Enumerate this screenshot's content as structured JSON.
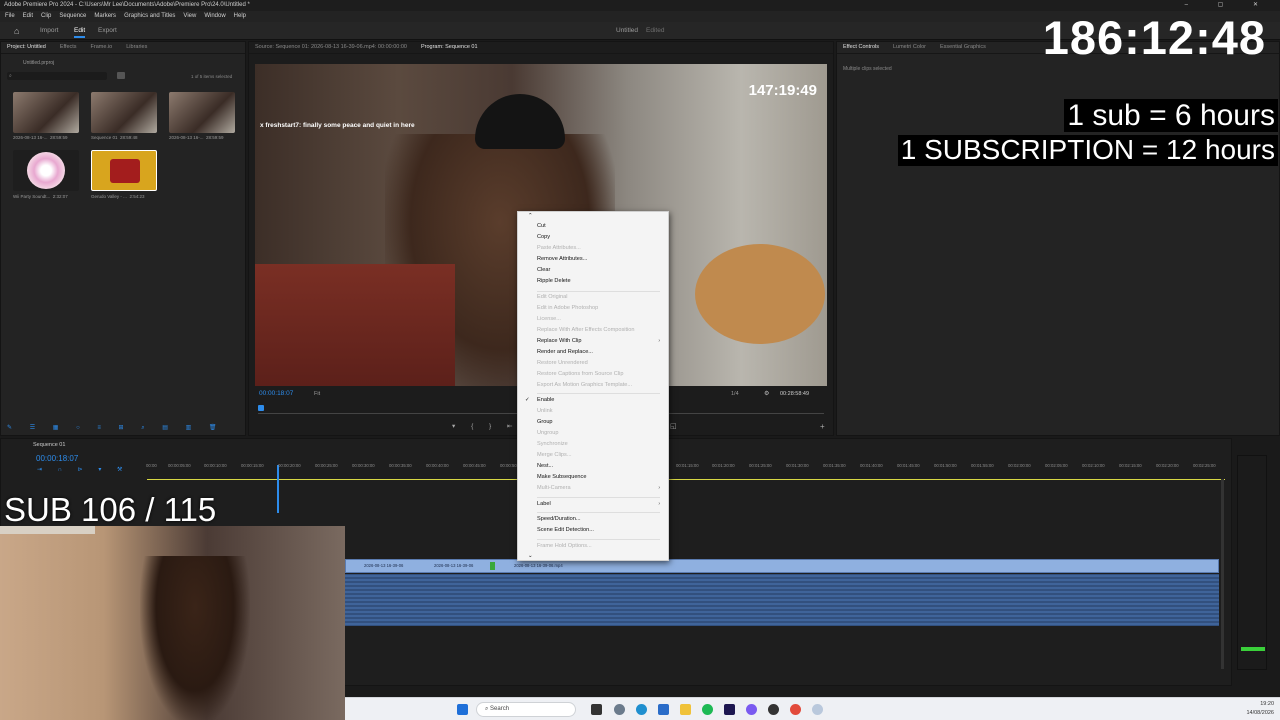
{
  "app": {
    "title": "Adobe Premiere Pro 2024 - C:\\Users\\Mr Lee\\Documents\\Adobe\\Premiere Pro\\24.0\\Untitled *",
    "menu": [
      "File",
      "Edit",
      "Clip",
      "Sequence",
      "Markers",
      "Graphics and Titles",
      "View",
      "Window",
      "Help"
    ],
    "workspace_tabs": [
      "Import",
      "Edit",
      "Export"
    ],
    "active_workspace": "Edit",
    "doc_title": "Untitled",
    "doc_status": "Edited"
  },
  "project_panel": {
    "tabs": [
      "Project: Untitled",
      "Effects",
      "Frame.io",
      "Libraries"
    ],
    "project_file": "Untitled.prproj",
    "selection_info": "1 of 5 items selected",
    "items": [
      {
        "name": "2026-08-13 16-...",
        "duration": "28:59:59",
        "color": "#6b5a52"
      },
      {
        "name": "Sequence 01",
        "duration": "28:59:48",
        "color": "#6b5a52"
      },
      {
        "name": "2026-08-13 16-...",
        "duration": "28:59:59",
        "color": "#6b5a52"
      },
      {
        "name": "Wii Party Soundt...",
        "duration": "2:32:07",
        "color": "#e8c6d8"
      },
      {
        "name": "Gerudo Valley - ...",
        "duration": "2:54:23",
        "color": "#d8a51e"
      }
    ]
  },
  "source_monitor": {
    "tab": "Source: Sequence 01: 2026-08-13 16-39-06.mp4: 00:00:00:00",
    "program_tab": "Program: Sequence 01"
  },
  "program_monitor": {
    "overlay_timecode": "147:19:49",
    "chat_message": "x freshstart7: finally some peace and quiet in here",
    "current_time": "00:00:18:07",
    "fit": "Fit",
    "quality": "1/4",
    "duration": "00:28:58:49"
  },
  "effect_controls": {
    "tabs": [
      "Effect Controls",
      "Lumetri Color",
      "Essential Graphics"
    ],
    "status": "Multiple clips selected"
  },
  "context_menu": {
    "items": [
      {
        "label": "Cut",
        "enabled": true
      },
      {
        "label": "Copy",
        "enabled": true
      },
      {
        "label": "Paste Attributes...",
        "enabled": false
      },
      {
        "label": "Remove Attributes...",
        "enabled": true
      },
      {
        "label": "Clear",
        "enabled": true
      },
      {
        "label": "Ripple Delete",
        "enabled": true
      },
      {
        "label": "Edit Original",
        "enabled": false
      },
      {
        "label": "Edit in Adobe Photoshop",
        "enabled": false
      },
      {
        "label": "License...",
        "enabled": false
      },
      {
        "label": "Replace With After Effects Composition",
        "enabled": false
      },
      {
        "label": "Replace With Clip",
        "enabled": true,
        "submenu": true
      },
      {
        "label": "Render and Replace...",
        "enabled": true
      },
      {
        "label": "Restore Unrendered",
        "enabled": false
      },
      {
        "label": "Restore Captions from Source Clip",
        "enabled": false
      },
      {
        "label": "Export As Motion Graphics Template...",
        "enabled": false
      },
      {
        "label": "Enable",
        "enabled": true,
        "checked": true
      },
      {
        "label": "Unlink",
        "enabled": false
      },
      {
        "label": "Group",
        "enabled": true
      },
      {
        "label": "Ungroup",
        "enabled": false
      },
      {
        "label": "Synchronize",
        "enabled": false
      },
      {
        "label": "Merge Clips...",
        "enabled": false
      },
      {
        "label": "Nest...",
        "enabled": true
      },
      {
        "label": "Make Subsequence",
        "enabled": true
      },
      {
        "label": "Multi-Camera",
        "enabled": false,
        "submenu": true
      },
      {
        "label": "Label",
        "enabled": true,
        "submenu": true
      },
      {
        "label": "Speed/Duration...",
        "enabled": true
      },
      {
        "label": "Scene Edit Detection...",
        "enabled": true
      },
      {
        "label": "Frame Hold Options...",
        "enabled": false
      }
    ]
  },
  "timeline": {
    "tab": "Sequence 01",
    "current_time": "00:00:18:07",
    "ruler": [
      "00:00",
      "00:00:05:00",
      "00:00:10:00",
      "00:00:15:00",
      "00:00:20:00",
      "00:00:25:00",
      "00:00:30:00",
      "00:00:35:00",
      "00:00:40:00",
      "00:00:45:00",
      "00:00:50:00",
      "00:01:15:00",
      "00:01:20:00",
      "00:01:25:00",
      "00:01:30:00",
      "00:01:35:00",
      "00:01:40:00",
      "00:01:45:00",
      "00:01:50:00",
      "00:01:55:00",
      "00:02:00:00",
      "00:02:05:00",
      "00:02:10:00",
      "00:02:15:00",
      "00:02:20:00",
      "00:02:25:00"
    ],
    "clips": [
      "2026-08-13 16-39-06",
      "2026-08-13 16-39-06",
      "2026-08-13 16-39-06.mp4"
    ]
  },
  "stream_overlay": {
    "big_timer": "186:12:48",
    "promo_line1": "1 sub = 6 hours",
    "promo_line2": "1 SUBSCRIPTION = 12 hours",
    "sub_counter": "SUB 106 / 115"
  },
  "taskbar": {
    "search_placeholder": "Search",
    "time": "19:20",
    "date": "14/08/2026"
  }
}
